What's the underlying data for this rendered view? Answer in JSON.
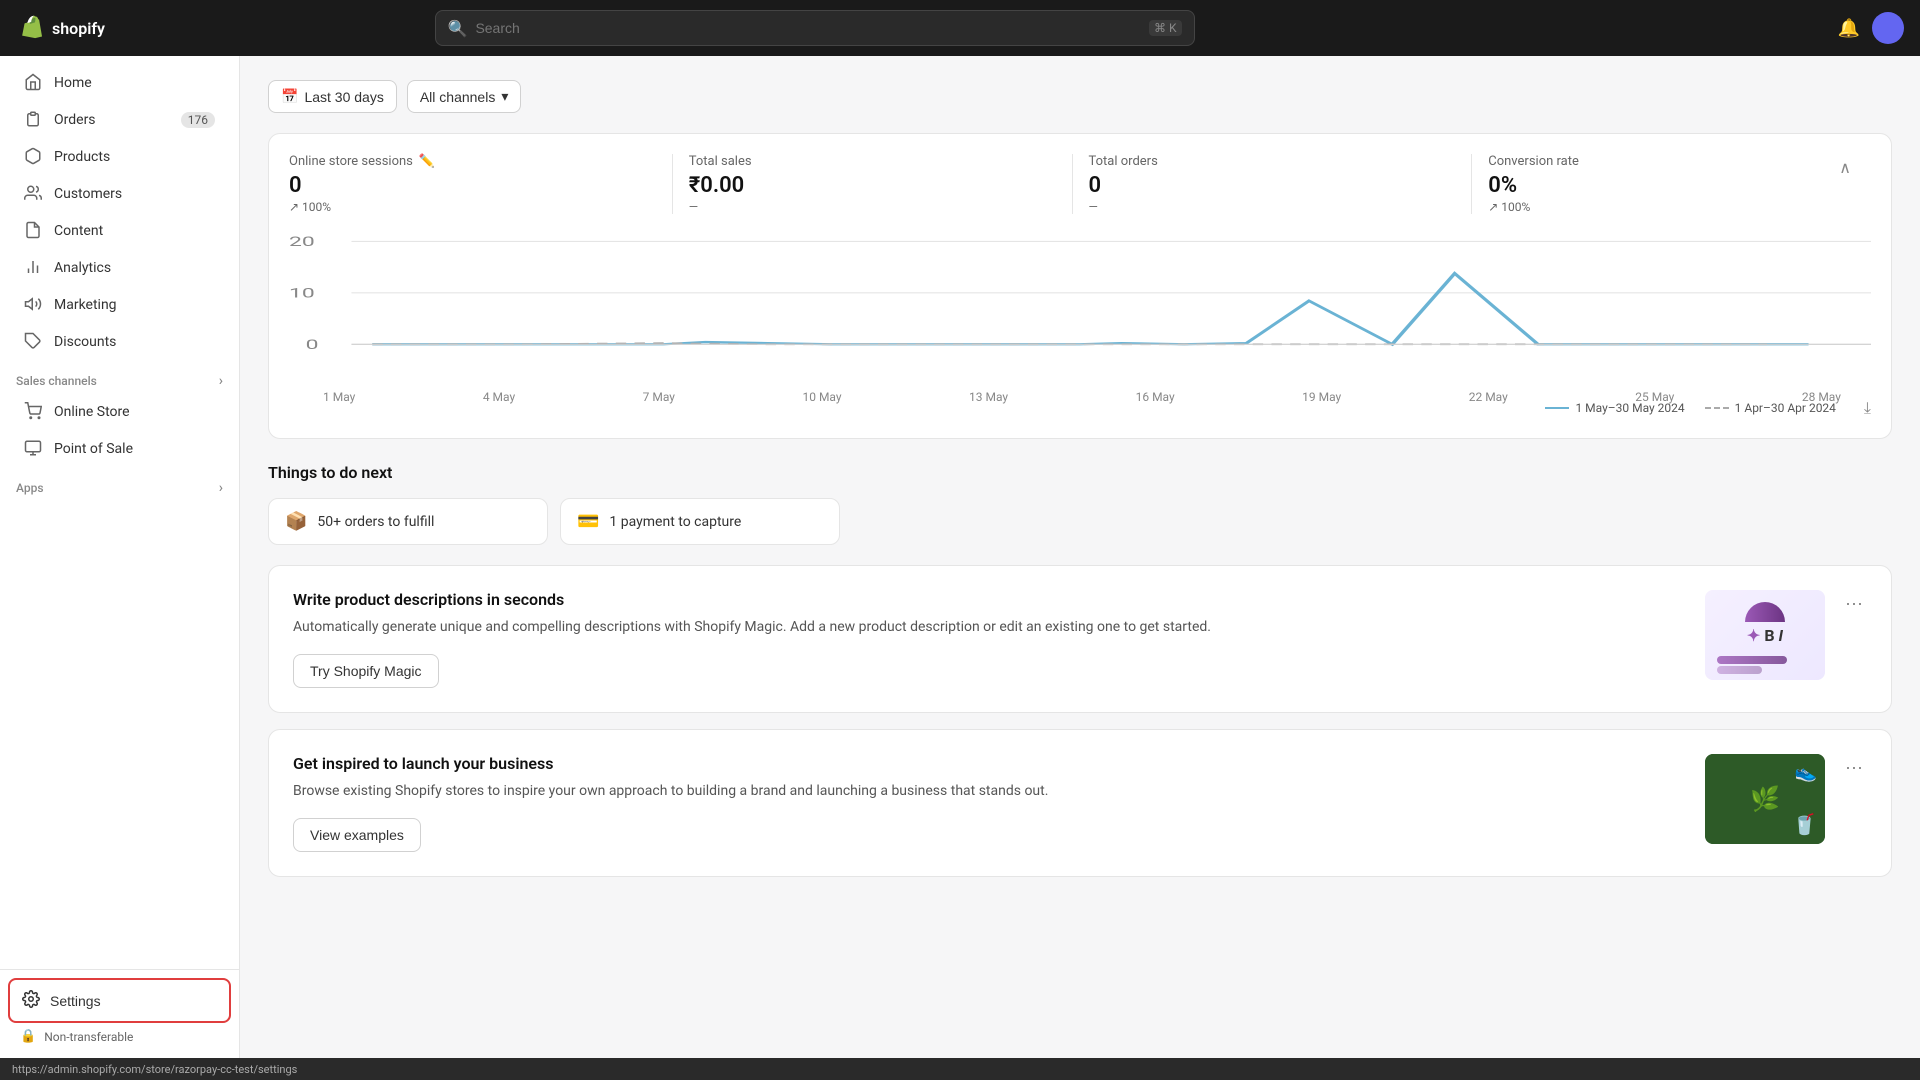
{
  "topbar": {
    "logo_text": "shopify",
    "search_placeholder": "Search",
    "search_shortcut": "⌘ K",
    "bell_label": "Notifications"
  },
  "sidebar": {
    "nav_items": [
      {
        "id": "home",
        "label": "Home",
        "icon": "home"
      },
      {
        "id": "orders",
        "label": "Orders",
        "icon": "orders",
        "badge": "176"
      },
      {
        "id": "products",
        "label": "Products",
        "icon": "products"
      },
      {
        "id": "customers",
        "label": "Customers",
        "icon": "customers"
      },
      {
        "id": "content",
        "label": "Content",
        "icon": "content"
      },
      {
        "id": "analytics",
        "label": "Analytics",
        "icon": "analytics"
      },
      {
        "id": "marketing",
        "label": "Marketing",
        "icon": "marketing"
      },
      {
        "id": "discounts",
        "label": "Discounts",
        "icon": "discounts"
      }
    ],
    "sales_channels_label": "Sales channels",
    "sales_channels": [
      {
        "id": "online-store",
        "label": "Online Store",
        "icon": "store"
      },
      {
        "id": "point-of-sale",
        "label": "Point of Sale",
        "icon": "pos"
      }
    ],
    "apps_label": "Apps",
    "settings_label": "Settings",
    "non_transferable_label": "Non-transferable"
  },
  "filters": {
    "date_range": "Last 30 days",
    "channels": "All channels"
  },
  "stats": {
    "online_sessions": {
      "label": "Online store sessions",
      "value": "0",
      "change": "↗ 100%"
    },
    "total_sales": {
      "label": "Total sales",
      "value": "₹0.00",
      "change": "—"
    },
    "total_orders": {
      "label": "Total orders",
      "value": "0",
      "change": "—"
    },
    "conversion_rate": {
      "label": "Conversion rate",
      "value": "0%",
      "change": "↗ 100%"
    }
  },
  "chart": {
    "y_labels": [
      "20",
      "10",
      "0"
    ],
    "x_labels": [
      "1 May",
      "4 May",
      "7 May",
      "10 May",
      "13 May",
      "16 May",
      "19 May",
      "22 May",
      "25 May",
      "28 May"
    ],
    "legend": [
      {
        "label": "1 May–30 May 2024",
        "style": "solid"
      },
      {
        "label": "1 Apr–30 Apr 2024",
        "style": "dashed"
      }
    ]
  },
  "things_to_do": {
    "title": "Things to do next",
    "actions": [
      {
        "id": "fulfill-orders",
        "label": "50+ orders to fulfill",
        "icon": "box"
      },
      {
        "id": "capture-payment",
        "label": "1 payment to capture",
        "icon": "payment"
      }
    ]
  },
  "feature_cards": [
    {
      "id": "shopify-magic",
      "title": "Write product descriptions in seconds",
      "description": "Automatically generate unique and compelling descriptions with Shopify Magic. Add a new product description or edit an existing one to get started.",
      "cta_label": "Try Shopify Magic"
    },
    {
      "id": "launch-business",
      "title": "Get inspired to launch your business",
      "description": "Browse existing Shopify stores to inspire your own approach to building a brand and launching a business that stands out.",
      "cta_label": "View examples"
    }
  ],
  "status_bar": {
    "url": "https://admin.shopify.com/store/razorpay-cc-test/settings"
  }
}
